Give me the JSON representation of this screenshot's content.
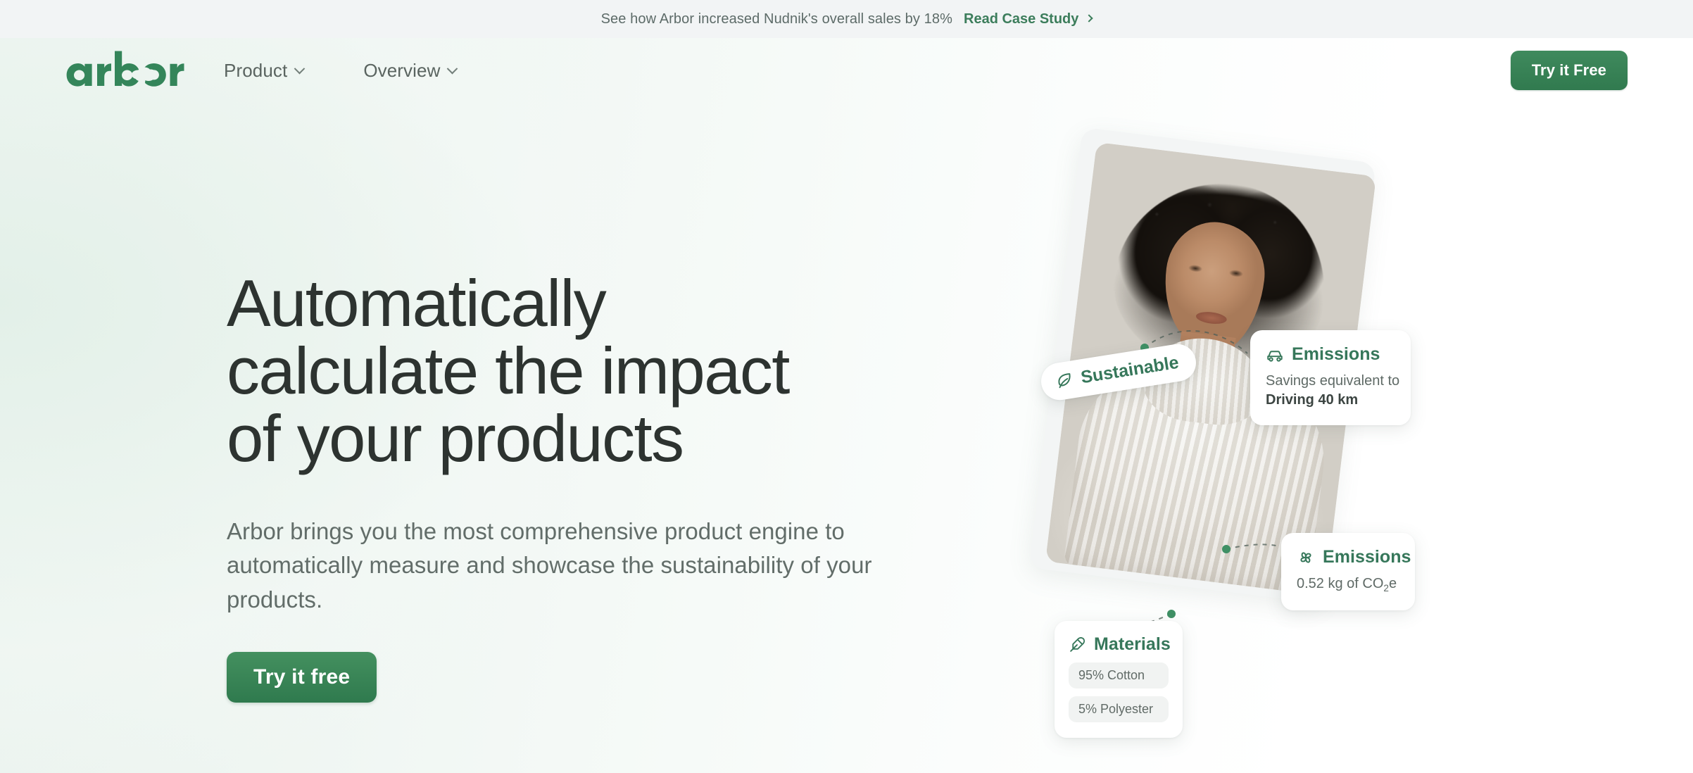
{
  "announcement": {
    "text": "See how Arbor increased Nudnik's overall sales by 18%",
    "link_label": "Read Case Study",
    "arrow_icon": "chevron-right-icon"
  },
  "header": {
    "logo_text": "arbor",
    "nav": [
      {
        "label": "Product",
        "icon": "chevron-down-icon"
      },
      {
        "label": "Overview",
        "icon": "chevron-down-icon"
      }
    ],
    "cta_label": "Try it Free"
  },
  "hero": {
    "title": "Automatically calculate the impact of your products",
    "subtitle": "Arbor brings you the most comprehensive product engine to automatically measure and showcase the sustainability of your products.",
    "cta_label": "Try it free"
  },
  "hero_visual": {
    "badge": {
      "label": "Sustainable",
      "icon": "leaf-icon"
    },
    "cards": [
      {
        "name": "emissions-driving",
        "icon": "car-icon",
        "title": "Emissions",
        "line1": "Savings equivalent to",
        "line2": "Driving 40 km"
      },
      {
        "name": "emissions-co2",
        "icon": "pinwheel-icon",
        "title": "Emissions",
        "value_prefix": "0.52 kg of CO",
        "value_sub": "2",
        "value_suffix": "e"
      },
      {
        "name": "materials",
        "icon": "feather-icon",
        "title": "Materials",
        "chips": [
          "95% Cotton",
          "5% Polyester"
        ]
      }
    ],
    "photo_alt": "Woman in cream cable-knit sweater"
  },
  "colors": {
    "brand_green": "#36775a",
    "logo_green": "#34855a",
    "cta_green": "#357c52",
    "announce_bg": "#f2f4f5",
    "text_dark": "#2d3330",
    "text_muted": "#626d69"
  }
}
